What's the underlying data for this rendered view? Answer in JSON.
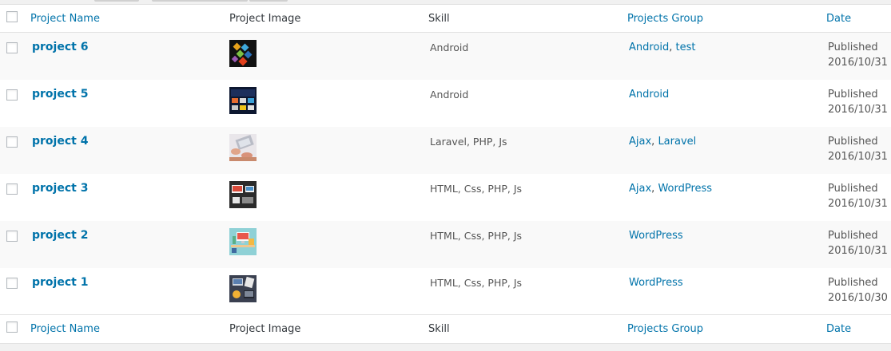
{
  "columns": {
    "name": "Project Name",
    "image": "Project Image",
    "skill": "Skill",
    "group": "Projects Group",
    "date": "Date"
  },
  "rows": [
    {
      "title": "project 6",
      "skill": "Android",
      "groups": [
        {
          "label": "Android"
        },
        {
          "label": "test"
        }
      ],
      "status": "Published",
      "date": "2016/10/31",
      "thumb_icon": "colorful-cubes-thumbnail"
    },
    {
      "title": "project 5",
      "skill": "Android",
      "groups": [
        {
          "label": "Android"
        }
      ],
      "status": "Published",
      "date": "2016/10/31",
      "thumb_icon": "app-screens-thumbnail"
    },
    {
      "title": "project 4",
      "skill": "Laravel, PHP, Js",
      "groups": [
        {
          "label": "Ajax"
        },
        {
          "label": "Laravel"
        }
      ],
      "status": "Published",
      "date": "2016/10/31",
      "thumb_icon": "laptop-hands-thumbnail"
    },
    {
      "title": "project 3",
      "skill": "HTML, Css, PHP, Js",
      "groups": [
        {
          "label": "Ajax"
        },
        {
          "label": "WordPress"
        }
      ],
      "status": "Published",
      "date": "2016/10/31",
      "thumb_icon": "desk-devices-thumbnail"
    },
    {
      "title": "project 2",
      "skill": "HTML, Css, PHP, Js",
      "groups": [
        {
          "label": "WordPress"
        }
      ],
      "status": "Published",
      "date": "2016/10/31",
      "thumb_icon": "flat-workspace-thumbnail"
    },
    {
      "title": "project 1",
      "skill": "HTML, Css, PHP, Js",
      "groups": [
        {
          "label": "WordPress"
        }
      ],
      "status": "Published",
      "date": "2016/10/30",
      "thumb_icon": "dark-workspace-thumbnail"
    }
  ],
  "colors": {
    "link": "#0073aa",
    "text": "#555555",
    "row_alt": "#f9f9f9",
    "border": "#e1e1e1"
  }
}
